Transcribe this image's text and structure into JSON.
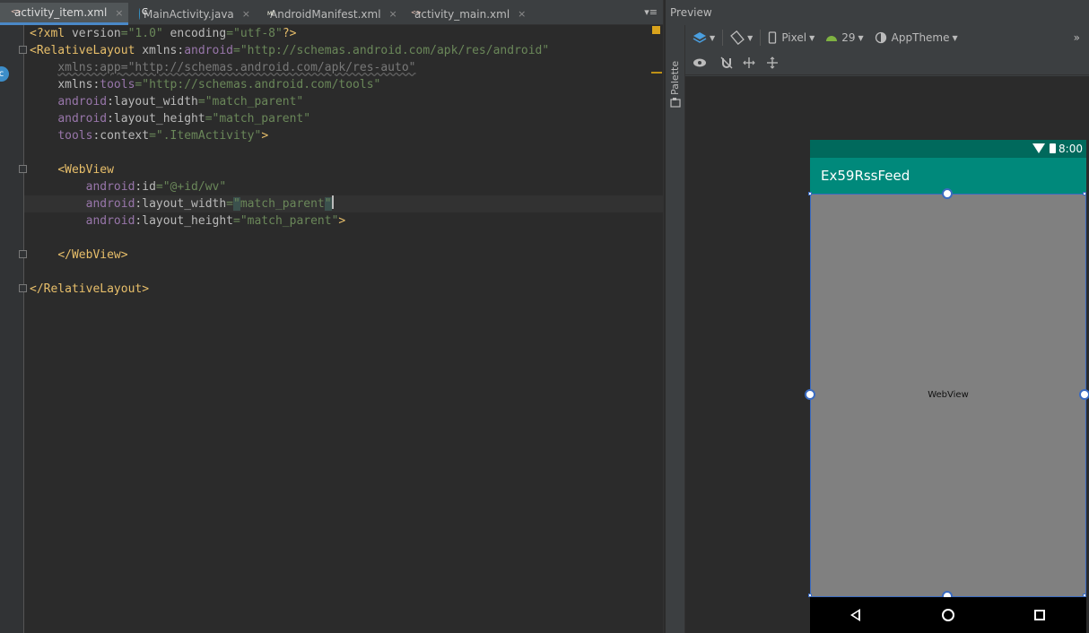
{
  "tabs": [
    {
      "label": "activity_item.xml",
      "type": "xml",
      "active": true
    },
    {
      "label": "MainActivity.java",
      "type": "java",
      "active": false
    },
    {
      "label": "AndroidManifest.xml",
      "type": "mf",
      "active": false
    },
    {
      "label": "activity_main.xml",
      "type": "xml",
      "active": false
    }
  ],
  "tab_overflow": "≡",
  "tab_close": "×",
  "code": {
    "l1_pi_open": "<?xml ",
    "l1_attr1": "version",
    "l1_eq1": "=",
    "l1_val1": "\"1.0\"",
    "l1_attr2": " encoding",
    "l1_eq2": "=",
    "l1_val2": "\"utf-8\"",
    "l1_pi_close": "?>",
    "l2_tag": "<RelativeLayout ",
    "l2_attr": "xmlns:",
    "l2_ns": "android",
    "l2_eq": "=",
    "l2_val": "\"http://schemas.android.com/apk/res/android\"",
    "l3_attr": "xmlns:app",
    "l3_eq": "=",
    "l3_val": "\"http://schemas.android.com/apk/res-auto\"",
    "l4_attr": "xmlns:",
    "l4_ns": "tools",
    "l4_eq": "=",
    "l4_val": "\"http://schemas.android.com/tools\"",
    "l5_ns": "android",
    "l5_attr": ":layout_width",
    "l5_eq": "=",
    "l5_val": "\"match_parent\"",
    "l6_ns": "android",
    "l6_attr": ":layout_height",
    "l6_eq": "=",
    "l6_val": "\"match_parent\"",
    "l7_ns": "tools",
    "l7_attr": ":context",
    "l7_eq": "=",
    "l7_val": "\".ItemActivity\"",
    "l7_close": ">",
    "l9_tag": "<WebView",
    "l10_ns": "android",
    "l10_attr": ":id",
    "l10_eq": "=",
    "l10_val": "\"@+id/wv\"",
    "l11_ns": "android",
    "l11_attr": ":layout_width",
    "l11_eq": "=",
    "l11_q1": "\"",
    "l11_val": "match_parent",
    "l11_q2": "\"",
    "l12_ns": "android",
    "l12_attr": ":layout_height",
    "l12_eq": "=",
    "l12_val": "\"match_parent\"",
    "l12_close": ">",
    "l14_tag": "</WebView>",
    "l16_tag": "</RelativeLayout>"
  },
  "preview": {
    "title": "Preview",
    "palette_label": "Palette",
    "device": "Pixel",
    "api_level": "29",
    "theme": "AppTheme",
    "more": "»"
  },
  "device_screen": {
    "status_time": "8:00",
    "app_title": "Ex59RssFeed",
    "webview_label": "WebView",
    "statusbar_color": "#00695c",
    "appbar_color": "#00897b"
  }
}
